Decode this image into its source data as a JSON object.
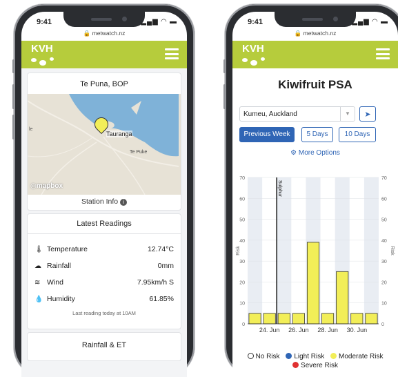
{
  "left": {
    "status_time": "9:41",
    "url": "metwatch.nz",
    "logo_text": "KVH",
    "location_title": "Te Puna, BOP",
    "map": {
      "city_label": "Tauranga",
      "town_label": "Te Puke",
      "edge_label": "le",
      "attribution": "mapbox"
    },
    "station_info": "Station Info",
    "latest_title": "Latest Readings",
    "readings": [
      {
        "icon": "thermometer-icon",
        "label": "Temperature",
        "value": "12.74°C"
      },
      {
        "icon": "rain-cloud-icon",
        "label": "Rainfall",
        "value": "0mm"
      },
      {
        "icon": "wind-icon",
        "label": "Wind",
        "value": "7.95km/h S"
      },
      {
        "icon": "drop-icon",
        "label": "Humidity",
        "value": "61.85%"
      }
    ],
    "last_reading": "Last reading today at 10AM",
    "rainfall_title": "Rainfall & ET"
  },
  "right": {
    "status_time": "9:41",
    "url": "metwatch.nz",
    "logo_text": "KVH",
    "page_title": "Kiwifruit PSA",
    "location_value": "Kumeu, Auckland",
    "buttons": {
      "previous_week": "Previous Week",
      "five_days": "5 Days",
      "ten_days": "10 Days"
    },
    "more_options": "More Options",
    "legend": [
      {
        "label": "No Risk",
        "color": "#ffffff"
      },
      {
        "label": "Light Risk",
        "color": "#2f65b5"
      },
      {
        "label": "Moderate Risk",
        "color": "#f2ee58"
      },
      {
        "label": "Severe Risk",
        "color": "#e03131"
      }
    ]
  },
  "chart_data": {
    "type": "bar",
    "x_ticks": [
      "24. Jun",
      "26. Jun",
      "28. Jun",
      "30. Jun"
    ],
    "x": [
      23,
      24,
      25,
      26,
      27,
      28,
      29,
      30,
      31
    ],
    "values": [
      5,
      5,
      5,
      5,
      39,
      5,
      25,
      5,
      5
    ],
    "ylabel": "Risk",
    "ylim": [
      0,
      70
    ],
    "yticks": [
      0,
      10,
      20,
      30,
      40,
      50,
      60,
      70
    ],
    "annotation": {
      "label": "Sulphur",
      "x": 24.5
    },
    "bar_color": "#f2ee58",
    "grid": true
  }
}
